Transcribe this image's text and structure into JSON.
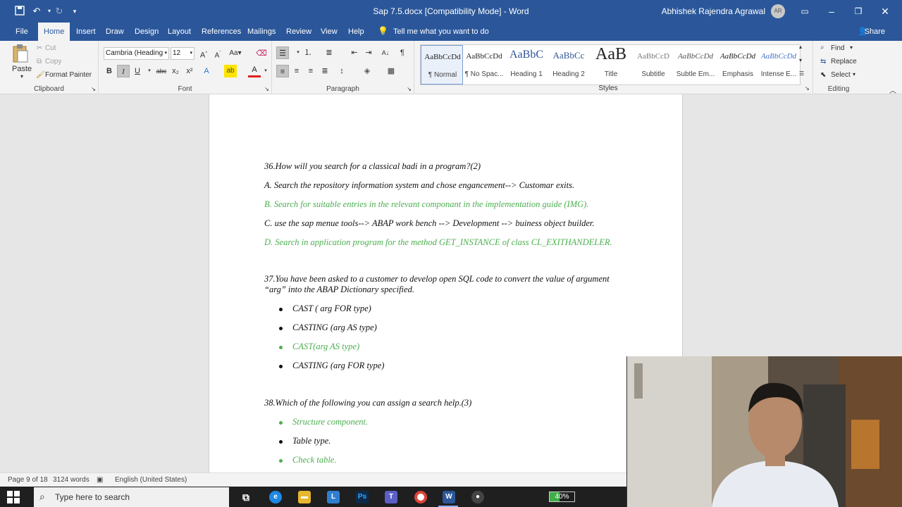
{
  "titlebar": {
    "doc_title": "Sap 7.5.docx [Compatibility Mode]  -  Word",
    "user_name": "Abhishek Rajendra Agrawal",
    "avatar_initials": "AR"
  },
  "tabs": [
    "File",
    "Home",
    "Insert",
    "Draw",
    "Design",
    "Layout",
    "References",
    "Mailings",
    "Review",
    "View",
    "Help"
  ],
  "tell_me": "Tell me what you want to do",
  "share": "Share",
  "clipboard": {
    "paste": "Paste",
    "cut": "Cut",
    "copy": "Copy",
    "format_painter": "Format Painter",
    "label": "Clipboard"
  },
  "font": {
    "name": "Cambria (Heading",
    "size": "12",
    "label": "Font",
    "bold": "B",
    "italic": "I",
    "underline": "U",
    "strike": "abc",
    "subscript": "x₂",
    "superscript": "x²"
  },
  "paragraph": {
    "label": "Paragraph"
  },
  "styles": {
    "label": "Styles",
    "items": [
      {
        "sample": "AaBbCcDd",
        "name": "¶ Normal"
      },
      {
        "sample": "AaBbCcDd",
        "name": "¶ No Spac..."
      },
      {
        "sample": "AaBbC",
        "name": "Heading 1"
      },
      {
        "sample": "AaBbCc",
        "name": "Heading 2"
      },
      {
        "sample": "AaB",
        "name": "Title"
      },
      {
        "sample": "AaBbCcD",
        "name": "Subtitle"
      },
      {
        "sample": "AaBbCcDd",
        "name": "Subtle Em..."
      },
      {
        "sample": "AaBbCcDd",
        "name": "Emphasis"
      },
      {
        "sample": "AaBbCcDd",
        "name": "Intense E..."
      }
    ]
  },
  "editing": {
    "label": "Editing",
    "find": "Find",
    "replace": "Replace",
    "select": "Select"
  },
  "document": {
    "q36": "36.How will you search for a classical badi in a program?(2)",
    "q36_a": "A. Search the repository information system and chose engancement--> Customar exits.",
    "q36_b": "B.  Search for suitable entries in the relevant componant in the implementation guide (IMG).",
    "q36_c": "C. use the sap menue tools--> ABAP work bench --> Development --> buiness object builder.",
    "q36_d": "D. Search in application program for the method GET_INSTANCE of class CL_EXITHANDELER.",
    "q37": "37.You have been asked to a customer to develop open SQL code to convert the value of argument “arg” into the ABAP Dictionary specified.",
    "q37_options": [
      {
        "text": "CAST ( arg FOR type)",
        "correct": false
      },
      {
        "text": "CASTING (arg AS type)",
        "correct": false
      },
      {
        "text": "CAST(arg AS type)",
        "correct": true
      },
      {
        "text": "CASTING (arg FOR type)",
        "correct": false
      }
    ],
    "q38": "38.Which of the following you can assign a search help.(3)",
    "q38_options": [
      {
        "text": "Structure component.",
        "correct": true
      },
      {
        "text": "Table type.",
        "correct": false
      },
      {
        "text": "Check table.",
        "correct": true
      }
    ]
  },
  "statusbar": {
    "page": "Page 9 of 18",
    "words": "3124 words",
    "language": "English (United States)"
  },
  "taskbar": {
    "search_placeholder": "Type here to search",
    "battery": "40%",
    "battery_level": 0.4
  },
  "colors": {
    "word_blue": "#2b579a",
    "answer_green": "#4caf50"
  }
}
